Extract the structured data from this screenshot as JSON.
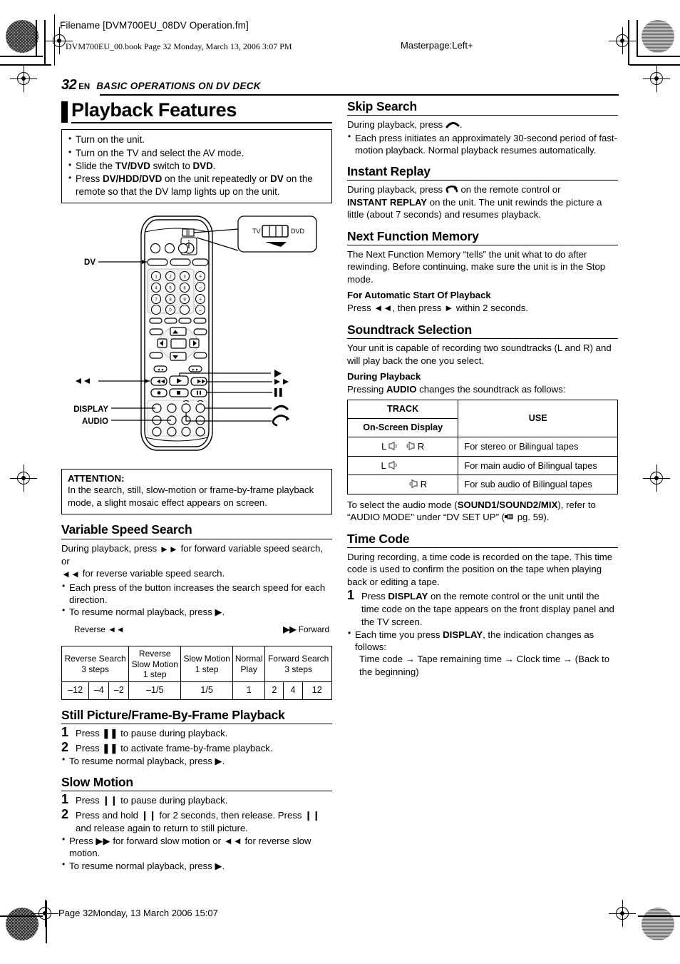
{
  "header": {
    "filename": "Filename [DVM700EU_08DV Operation.fm]",
    "bookline": "DVM700EU_00.book  Page 32  Monday, March 13, 2006  3:07 PM",
    "masterpage": "Masterpage:Left+"
  },
  "running_head": {
    "page_number": "32",
    "lang": "EN",
    "title": "BASIC OPERATIONS ON DV DECK"
  },
  "footer": {
    "text": "Page 32Monday, 13 March 2006  15:07"
  },
  "left_column": {
    "title": "Playback Features",
    "prep_box": [
      "Turn on the unit.",
      "Turn on the TV and select the AV mode.",
      "Slide the TV/DVD switch to DVD.",
      "Press DV/HDD/DVD on the unit repeatedly or DV on the remote so that the DV lamp lights up on the unit."
    ],
    "remote": {
      "callouts": {
        "dv": "DV",
        "rew": "◄◄",
        "display": "DISPLAY",
        "audio": "AUDIO",
        "play": "▶",
        "ff": "▶▶",
        "pause": "❙❙",
        "skip_search": "skip-search-arc",
        "instant_replay": "instant-replay-arc"
      },
      "switch_detail": {
        "left": "TV",
        "right": "DVD"
      }
    },
    "attention": {
      "heading": "ATTENTION:",
      "body": "In the search, still, slow-motion or frame-by-frame playback mode, a slight mosaic effect appears on screen."
    },
    "variable_speed_search": {
      "heading": "Variable Speed Search",
      "intro_a": "During playback, press ",
      "intro_b": " for forward variable speed search, or ",
      "intro_c": " for reverse variable speed search.",
      "bullets": [
        "Each press of the button increases the search speed for each direction.",
        "To resume normal playback, press ▶."
      ]
    },
    "speed_table": {
      "reverse_label": "Reverse",
      "forward_label": "Forward",
      "reverse_glyph": "◄◄",
      "forward_glyph": "▶▶",
      "headers": [
        "Reverse Search\n3 steps",
        "Reverse\nSlow Motion\n1 step",
        "Slow Motion\n1 step",
        "Normal\nPlay",
        "Forward Search\n3 steps"
      ],
      "values": [
        "–12",
        "–4",
        "–2",
        "–1/5",
        "1/5",
        "1",
        "2",
        "4",
        "12"
      ]
    },
    "still_picture": {
      "heading": "Still Picture/Frame-By-Frame Playback",
      "steps": [
        {
          "num": "1",
          "text_a": "Press ",
          "glyph": "pause",
          "text_b": " to pause during playback."
        },
        {
          "num": "2",
          "text_a": "Press ",
          "glyph": "pause",
          "text_b": " to activate frame-by-frame playback."
        }
      ],
      "bullets": [
        "To resume normal playback, press ▶."
      ]
    },
    "slow_motion": {
      "heading": "Slow Motion",
      "steps": [
        {
          "num": "1",
          "text": "Press ❙❙ to pause during playback."
        },
        {
          "num": "2",
          "text": "Press and hold ❙❙ for 2 seconds, then release. Press ❙❙ and release again to return to still picture."
        }
      ],
      "bullets": [
        "Press ▶▶ for forward slow motion or ◄◄ for reverse slow motion.",
        "To resume normal playback, press ▶."
      ]
    }
  },
  "right_column": {
    "skip_search": {
      "heading": "Skip Search",
      "intro": "During playback, press ",
      "intro_end": ".",
      "bullets": [
        "Each press initiates an approximately 30-second period of fast-motion playback. Normal playback resumes automatically."
      ]
    },
    "instant_replay": {
      "heading": "Instant Replay",
      "line1_a": "During playback, press ",
      "line1_b": " on the remote control or ",
      "bold": "INSTANT REPLAY",
      "line2": " on the unit. The unit rewinds the picture a little (about 7 seconds) and resumes playback."
    },
    "next_function_memory": {
      "heading": "Next Function Memory",
      "body": "The Next Function Memory “tells” the unit what to do after rewinding. Before continuing, make sure the unit is in the Stop mode.",
      "sub_heading": "For Automatic Start Of Playback",
      "sub_body_a": "Press ",
      "sub_body_b": ", then press ",
      "sub_body_c": " within 2 seconds."
    },
    "soundtrack_selection": {
      "heading": "Soundtrack Selection",
      "body": "Your unit is capable of recording two soundtracks (L and R) and will play back the one you select.",
      "sub_heading": "During Playback",
      "sub_body_a": "Pressing ",
      "sub_body_bold": "AUDIO",
      "sub_body_b": " changes the soundtrack as follows:",
      "table": {
        "h_track": "TRACK",
        "h_onscreen": "On-Screen Display",
        "h_use": "USE",
        "rows": [
          {
            "track": "both",
            "left": "L",
            "right": "R",
            "use": "For stereo or Bilingual tapes"
          },
          {
            "track": "left",
            "left": "L",
            "right": "",
            "use": "For main audio of Bilingual tapes"
          },
          {
            "track": "right",
            "left": "",
            "right": "R",
            "use": "For sub audio of Bilingual tapes"
          }
        ]
      },
      "after_a": "To select the audio mode (",
      "after_bold": "SOUND1/SOUND2/MIX",
      "after_b": "), refer to “AUDIO MODE” under “DV SET UP” (",
      "after_c": " pg. 59)."
    },
    "time_code": {
      "heading": "Time Code",
      "body": "During recording, a time code is recorded on the tape. This time code is used to confirm the position on the tape when playing back or editing a tape.",
      "step_num": "1",
      "step_a": "Press ",
      "step_bold": "DISPLAY",
      "step_b": " on the remote control or the unit until the time code on the tape appears on the front display panel and the TV screen.",
      "bullet_a": "Each time you press ",
      "bullet_bold": "DISPLAY",
      "bullet_b": ", the indication changes as follows:",
      "sequence": "Time code → Tape remaining time → Clock time → (Back to the beginning)"
    }
  }
}
